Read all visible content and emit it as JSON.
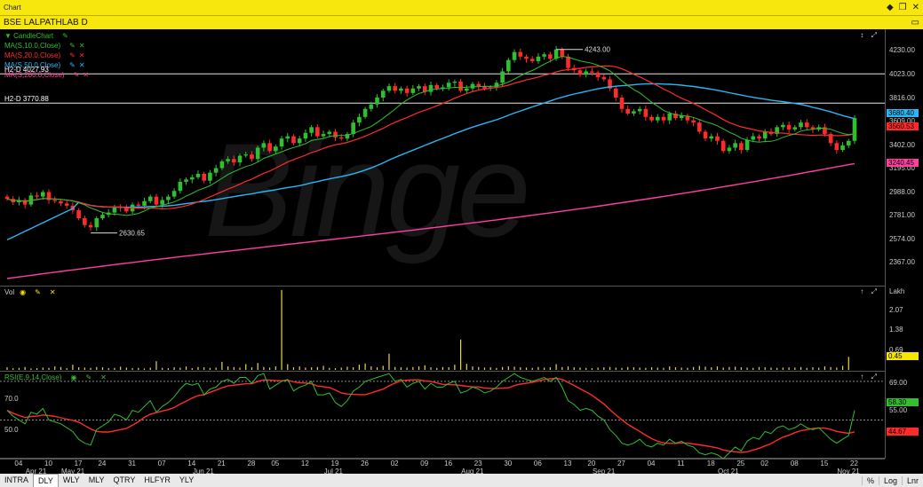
{
  "window": {
    "title": "Chart",
    "btn_pin": "◆",
    "btn_restore": "❐",
    "btn_close": "✕"
  },
  "symbol": {
    "name": "BSE LALPATHLAB D",
    "menu_icon": "▭"
  },
  "watermark": "Binge",
  "price_pane": {
    "legend": [
      {
        "label": "▼ CandleChart",
        "color": "#2fbf2f",
        "has_x": false
      },
      {
        "label": "MA(S,10.0,Close)",
        "color": "#2fbf2f",
        "has_x": true
      },
      {
        "label": "MA(S,20.0,Close)",
        "color": "#ff2b2b",
        "has_x": true
      },
      {
        "label": "MA(S,50.0,Close)",
        "color": "#29b6f6",
        "has_x": true
      },
      {
        "label": "MA(S,200.0,Close)",
        "color": "#ff3fa0",
        "has_x": true
      }
    ],
    "hline_labels": [
      {
        "text": "H2-D 4027.93",
        "value": 4027.93
      },
      {
        "text": "H2-D 3770.88",
        "value": 3770.88
      }
    ],
    "annotations": [
      {
        "text": "4243.00",
        "value": 4243.0
      },
      {
        "text": "2630.65",
        "value": 2630.65
      }
    ],
    "axis_ticks": [
      "4230.00",
      "4023.00",
      "3816.00",
      "3609.00",
      "3402.00",
      "3195.00",
      "2988.00",
      "2781.00",
      "2574.00",
      "2367.00"
    ],
    "axis_range": [
      2160,
      4420
    ],
    "value_tags": [
      {
        "text": "3680.40",
        "color": "#29b6f6",
        "value": 3680.4
      },
      {
        "text": "3560.53",
        "color": "#ff2b2b",
        "value": 3565
      },
      {
        "text": "3240.45",
        "color": "#ff3fa0",
        "value": 3240.45
      }
    ],
    "controls": "↕ ⤢"
  },
  "vol_pane": {
    "title": "Vol",
    "unit": "Lakh",
    "axis_ticks": [
      "2.07",
      "1.38",
      "0.69"
    ],
    "value_tag": {
      "text": "0.45",
      "color": "#f5e600"
    },
    "axis_max": 2.76,
    "controls": "↑ ⤢"
  },
  "rsi_pane": {
    "title": "RSI(E,9,14,Close)",
    "level_high": "70.0",
    "level_low": "50.0",
    "axis_ticks": [
      "69.00",
      "55.00"
    ],
    "value_tags": [
      {
        "text": "58.30",
        "color": "#2fbf2f",
        "value": 59
      },
      {
        "text": "44.67",
        "color": "#ff2b2b",
        "value": 44
      }
    ],
    "axis_range": [
      30,
      75
    ],
    "controls": "↑ ⤢"
  },
  "x_axis": {
    "months": [
      {
        "label": "Apr 21",
        "i": 1
      },
      {
        "label": "May 21",
        "i": 7
      },
      {
        "label": "Jun 21",
        "i": 29
      },
      {
        "label": "Jul 21",
        "i": 51
      },
      {
        "label": "Aug 21",
        "i": 74
      },
      {
        "label": "Sep 21",
        "i": 96
      },
      {
        "label": "Oct 21",
        "i": 117
      },
      {
        "label": "Nov 21",
        "i": 137
      }
    ],
    "days": [
      "04",
      "10",
      "17",
      "24",
      "31",
      "07",
      "14",
      "21",
      "28",
      "05",
      "12",
      "19",
      "26",
      "02",
      "09",
      "16",
      "23",
      "30",
      "06",
      "13",
      "20",
      "27",
      "04",
      "11",
      "18",
      "25",
      "02",
      "08",
      "15",
      "22"
    ]
  },
  "tabs": {
    "items": [
      "INTRA",
      "DLY",
      "WLY",
      "MLY",
      "QTRY",
      "HLFYR",
      "YLY"
    ],
    "active": "DLY",
    "right": [
      "%",
      "Log",
      "Lnr"
    ]
  },
  "colors": {
    "up": "#2fbf2f",
    "down": "#ff2b2b",
    "ma10": "#2fbf2f",
    "ma20": "#ff2b2b",
    "ma50": "#29b6f6",
    "ma200": "#ff3fa0",
    "volume": "#e8d84a",
    "rsi": "#2fbf2f",
    "rsi_signal": "#ff2b2b"
  },
  "chart_data": {
    "type": "candlestick",
    "title": "BSE LALPATHLAB D",
    "series_closes": [
      2930,
      2900,
      2920,
      2880,
      2960,
      2950,
      2990,
      2920,
      2910,
      2890,
      2870,
      2830,
      2760,
      2700,
      2680,
      2760,
      2790,
      2810,
      2860,
      2850,
      2820,
      2880,
      2870,
      2910,
      2950,
      2880,
      2920,
      2950,
      3000,
      3080,
      3100,
      3120,
      3150,
      3090,
      3160,
      3200,
      3260,
      3280,
      3250,
      3310,
      3320,
      3280,
      3380,
      3420,
      3350,
      3390,
      3460,
      3480,
      3420,
      3460,
      3510,
      3560,
      3480,
      3500,
      3520,
      3470,
      3460,
      3500,
      3600,
      3650,
      3720,
      3760,
      3820,
      3880,
      3920,
      3880,
      3900,
      3860,
      3900,
      3920,
      3870,
      3930,
      3900,
      3910,
      3950,
      3960,
      3880,
      3900,
      3940,
      3920,
      3900,
      3910,
      3950,
      4050,
      4150,
      4220,
      4180,
      4160,
      4140,
      4180,
      4200,
      4160,
      4243,
      4180,
      4080,
      4060,
      4020,
      4050,
      4040,
      4000,
      3980,
      3900,
      3820,
      3720,
      3680,
      3700,
      3720,
      3650,
      3620,
      3650,
      3620,
      3680,
      3640,
      3660,
      3620,
      3600,
      3520,
      3460,
      3480,
      3440,
      3350,
      3380,
      3420,
      3360,
      3450,
      3480,
      3460,
      3520,
      3500,
      3560,
      3580,
      3540,
      3560,
      3600,
      3560,
      3540,
      3560,
      3500,
      3420,
      3360,
      3400,
      3440,
      3640
    ],
    "y_ticks": [
      4230.0,
      4023.0,
      3816.0,
      3609.0,
      3402.0,
      3195.0,
      2988.0,
      2781.0,
      2574.0,
      2367.0
    ],
    "ma10_last": null,
    "ma20_last": 3560.53,
    "ma50_last": 3680.4,
    "ma200_last": 3240.45,
    "high": 4243.0,
    "low": 2630.65,
    "volume_lakh": [
      0.09,
      0.06,
      0.07,
      0.1,
      0.05,
      0.06,
      0.08,
      0.07,
      0.12,
      0.1,
      0.06,
      0.18,
      0.09,
      0.08,
      0.07,
      0.1,
      0.09,
      0.06,
      0.07,
      0.11,
      0.08,
      0.06,
      0.07,
      0.05,
      0.08,
      0.3,
      0.07,
      0.06,
      0.09,
      0.08,
      0.12,
      0.06,
      0.1,
      0.09,
      0.07,
      0.08,
      0.28,
      0.12,
      0.1,
      0.08,
      0.2,
      0.09,
      0.24,
      0.1,
      0.08,
      0.12,
      2.76,
      0.2,
      0.09,
      0.12,
      0.08,
      0.09,
      0.1,
      0.14,
      0.07,
      0.06,
      0.08,
      0.11,
      0.09,
      0.18,
      0.22,
      0.12,
      0.09,
      0.14,
      0.56,
      0.1,
      0.09,
      0.08,
      0.1,
      0.12,
      0.16,
      0.09,
      0.07,
      0.1,
      0.09,
      0.18,
      1.05,
      0.21,
      0.12,
      0.1,
      0.08,
      0.09,
      0.07,
      0.1,
      0.12,
      0.11,
      0.09,
      0.08,
      0.07,
      0.1,
      0.08,
      0.09,
      0.2,
      0.1,
      0.12,
      0.09,
      0.08,
      0.07,
      0.06,
      0.08,
      0.09,
      0.1,
      0.08,
      0.07,
      0.1,
      0.09,
      0.08,
      0.07,
      0.09,
      0.08,
      0.07,
      0.12,
      0.09,
      0.08,
      0.07,
      0.1,
      0.14,
      0.11,
      0.09,
      0.12,
      0.08,
      0.1,
      0.11,
      0.09,
      0.08,
      0.07,
      0.1,
      0.09,
      0.08,
      0.07,
      0.08,
      0.09,
      0.08,
      0.1,
      0.07,
      0.09,
      0.08,
      0.12,
      0.1,
      0.08,
      0.14,
      0.45
    ],
    "rsi": [
      55,
      52,
      50,
      48,
      54,
      53,
      56,
      50,
      49,
      48,
      46,
      44,
      40,
      38,
      37,
      45,
      47,
      49,
      53,
      52,
      50,
      55,
      54,
      57,
      60,
      54,
      57,
      59,
      62,
      66,
      69,
      68,
      69,
      63,
      66,
      67,
      70,
      71,
      69,
      72,
      72,
      69,
      73,
      74,
      66,
      68,
      70,
      71,
      65,
      67,
      68,
      70,
      63,
      63,
      64,
      59,
      57,
      60,
      65,
      67,
      70,
      71,
      72,
      73,
      74,
      70,
      71,
      67,
      69,
      70,
      66,
      69,
      67,
      67,
      69,
      70,
      64,
      65,
      67,
      66,
      64,
      65,
      67,
      70,
      72,
      74,
      72,
      71,
      70,
      71,
      72,
      70,
      72,
      67,
      60,
      58,
      55,
      56,
      55,
      52,
      50,
      45,
      42,
      38,
      37,
      38,
      40,
      37,
      36,
      38,
      37,
      40,
      38,
      39,
      37,
      36,
      33,
      32,
      33,
      32,
      30,
      33,
      36,
      34,
      39,
      41,
      40,
      44,
      43,
      46,
      47,
      45,
      46,
      48,
      46,
      45,
      46,
      43,
      40,
      38,
      40,
      42,
      55
    ]
  }
}
